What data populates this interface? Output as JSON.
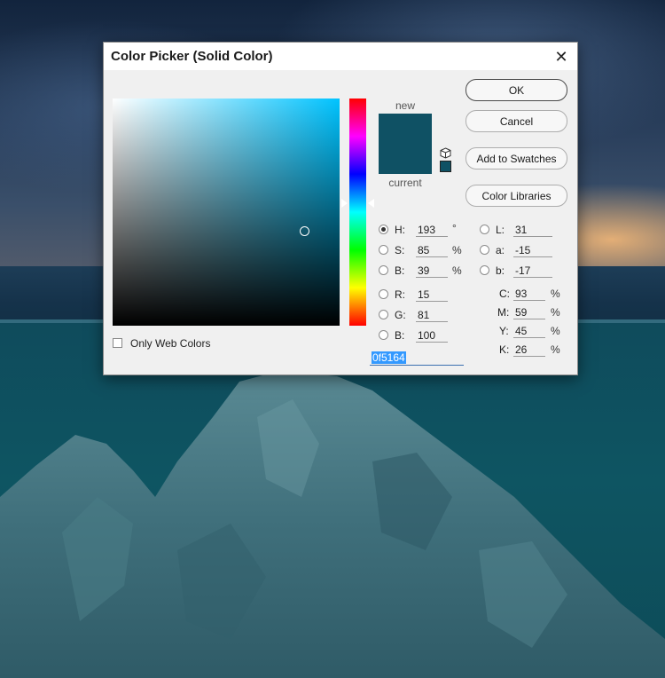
{
  "dialog": {
    "title": "Color Picker (Solid Color)",
    "close_glyph": "✕"
  },
  "preview": {
    "new_label": "new",
    "current_label": "current",
    "new_color": "#0f5164",
    "current_color": "#0f5164"
  },
  "buttons": {
    "ok": "OK",
    "cancel": "Cancel",
    "add_to_swatches": "Add to Swatches",
    "color_libraries": "Color Libraries"
  },
  "hsb": {
    "h_label": "H:",
    "h_value": "193",
    "h_unit": "°",
    "s_label": "S:",
    "s_value": "85",
    "s_unit": "%",
    "b_label": "B:",
    "b_value": "39",
    "b_unit": "%"
  },
  "rgb": {
    "r_label": "R:",
    "r_value": "15",
    "g_label": "G:",
    "g_value": "81",
    "b_label": "B:",
    "b_value": "100"
  },
  "lab": {
    "l_label": "L:",
    "l_value": "31",
    "a_label": "a:",
    "a_value": "-15",
    "b_label": "b:",
    "b_value": "-17"
  },
  "cmyk": {
    "c_label": "C:",
    "c_value": "93",
    "m_label": "M:",
    "m_value": "59",
    "y_label": "Y:",
    "y_value": "45",
    "k_label": "K:",
    "k_value": "26",
    "unit": "%"
  },
  "hex": {
    "hash": "#",
    "value": "0f5164"
  },
  "only_web_colors": {
    "label": "Only Web Colors",
    "checked": false
  },
  "colors": {
    "selected": "#0f5164",
    "hue_base": "#00c3ff"
  },
  "icons": {
    "websafe_cube": "cube-icon",
    "close": "close-icon"
  }
}
